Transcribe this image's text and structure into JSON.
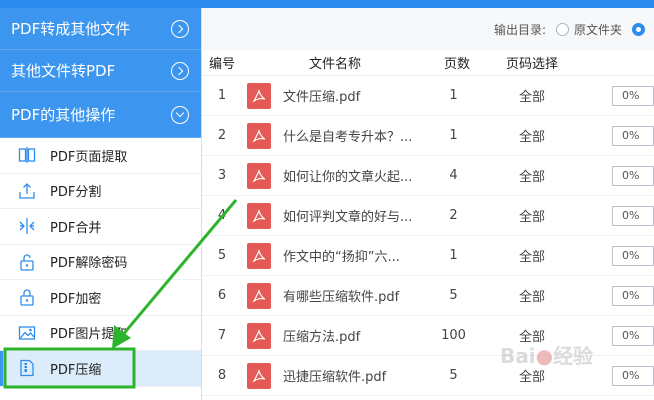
{
  "sidebar": {
    "categories": [
      {
        "label": "PDF转成其他文件"
      },
      {
        "label": "其他文件转PDF"
      },
      {
        "label": "PDF的其他操作"
      }
    ],
    "items": [
      {
        "label": "PDF页面提取"
      },
      {
        "label": "PDF分割"
      },
      {
        "label": "PDF合并"
      },
      {
        "label": "PDF解除密码"
      },
      {
        "label": "PDF加密"
      },
      {
        "label": "PDF图片提取"
      },
      {
        "label": "PDF压缩"
      }
    ]
  },
  "output": {
    "label": "输出目录:",
    "option": "原文件夹"
  },
  "table": {
    "headers": {
      "no": "编号",
      "name": "文件名称",
      "pages": "页数",
      "range": "页码选择"
    },
    "rows": [
      {
        "no": "1",
        "name": "文件压缩.pdf",
        "pages": "1",
        "range": "全部",
        "progress": "0%"
      },
      {
        "no": "2",
        "name": "什么是自考专升本？...",
        "pages": "1",
        "range": "全部",
        "progress": "0%"
      },
      {
        "no": "3",
        "name": "如何让你的文章火起...",
        "pages": "4",
        "range": "全部",
        "progress": "0%"
      },
      {
        "no": "4",
        "name": "如何评判文章的好与...",
        "pages": "2",
        "range": "全部",
        "progress": "0%"
      },
      {
        "no": "5",
        "name": "作文中的“扬抑”六...",
        "pages": "1",
        "range": "全部",
        "progress": "0%"
      },
      {
        "no": "6",
        "name": "有哪些压缩软件.pdf",
        "pages": "5",
        "range": "全部",
        "progress": "0%"
      },
      {
        "no": "7",
        "name": "压缩方法.pdf",
        "pages": "100",
        "range": "全部",
        "progress": "0%"
      },
      {
        "no": "8",
        "name": "迅捷压缩软件.pdf",
        "pages": "5",
        "range": "全部",
        "progress": "0%"
      }
    ]
  },
  "colors": {
    "accent": "#3c95ee",
    "annotation": "#2cb52c",
    "pdf_icon": "#e35a57"
  }
}
